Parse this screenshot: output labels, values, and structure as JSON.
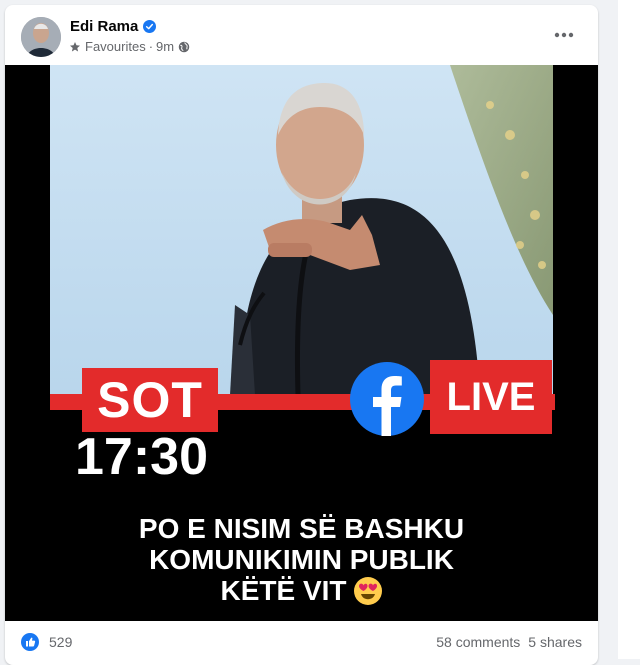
{
  "post": {
    "author": "Edi Rama",
    "audience": "Favourites",
    "time": "9m",
    "separator": "·"
  },
  "image": {
    "sot": "SOT",
    "time": "17:30",
    "live": "LIVE",
    "headline_lines": [
      "PO E NISIM SË BASHKU",
      "KOMUNIKIMIN PUBLIK",
      "KËTË VIT"
    ]
  },
  "footer": {
    "reaction_count": "529",
    "comments": "58 comments",
    "shares": "5 shares"
  },
  "colors": {
    "accent_red": "#e32b2b",
    "facebook_blue": "#1877f2",
    "meta_gray": "#65676b"
  }
}
